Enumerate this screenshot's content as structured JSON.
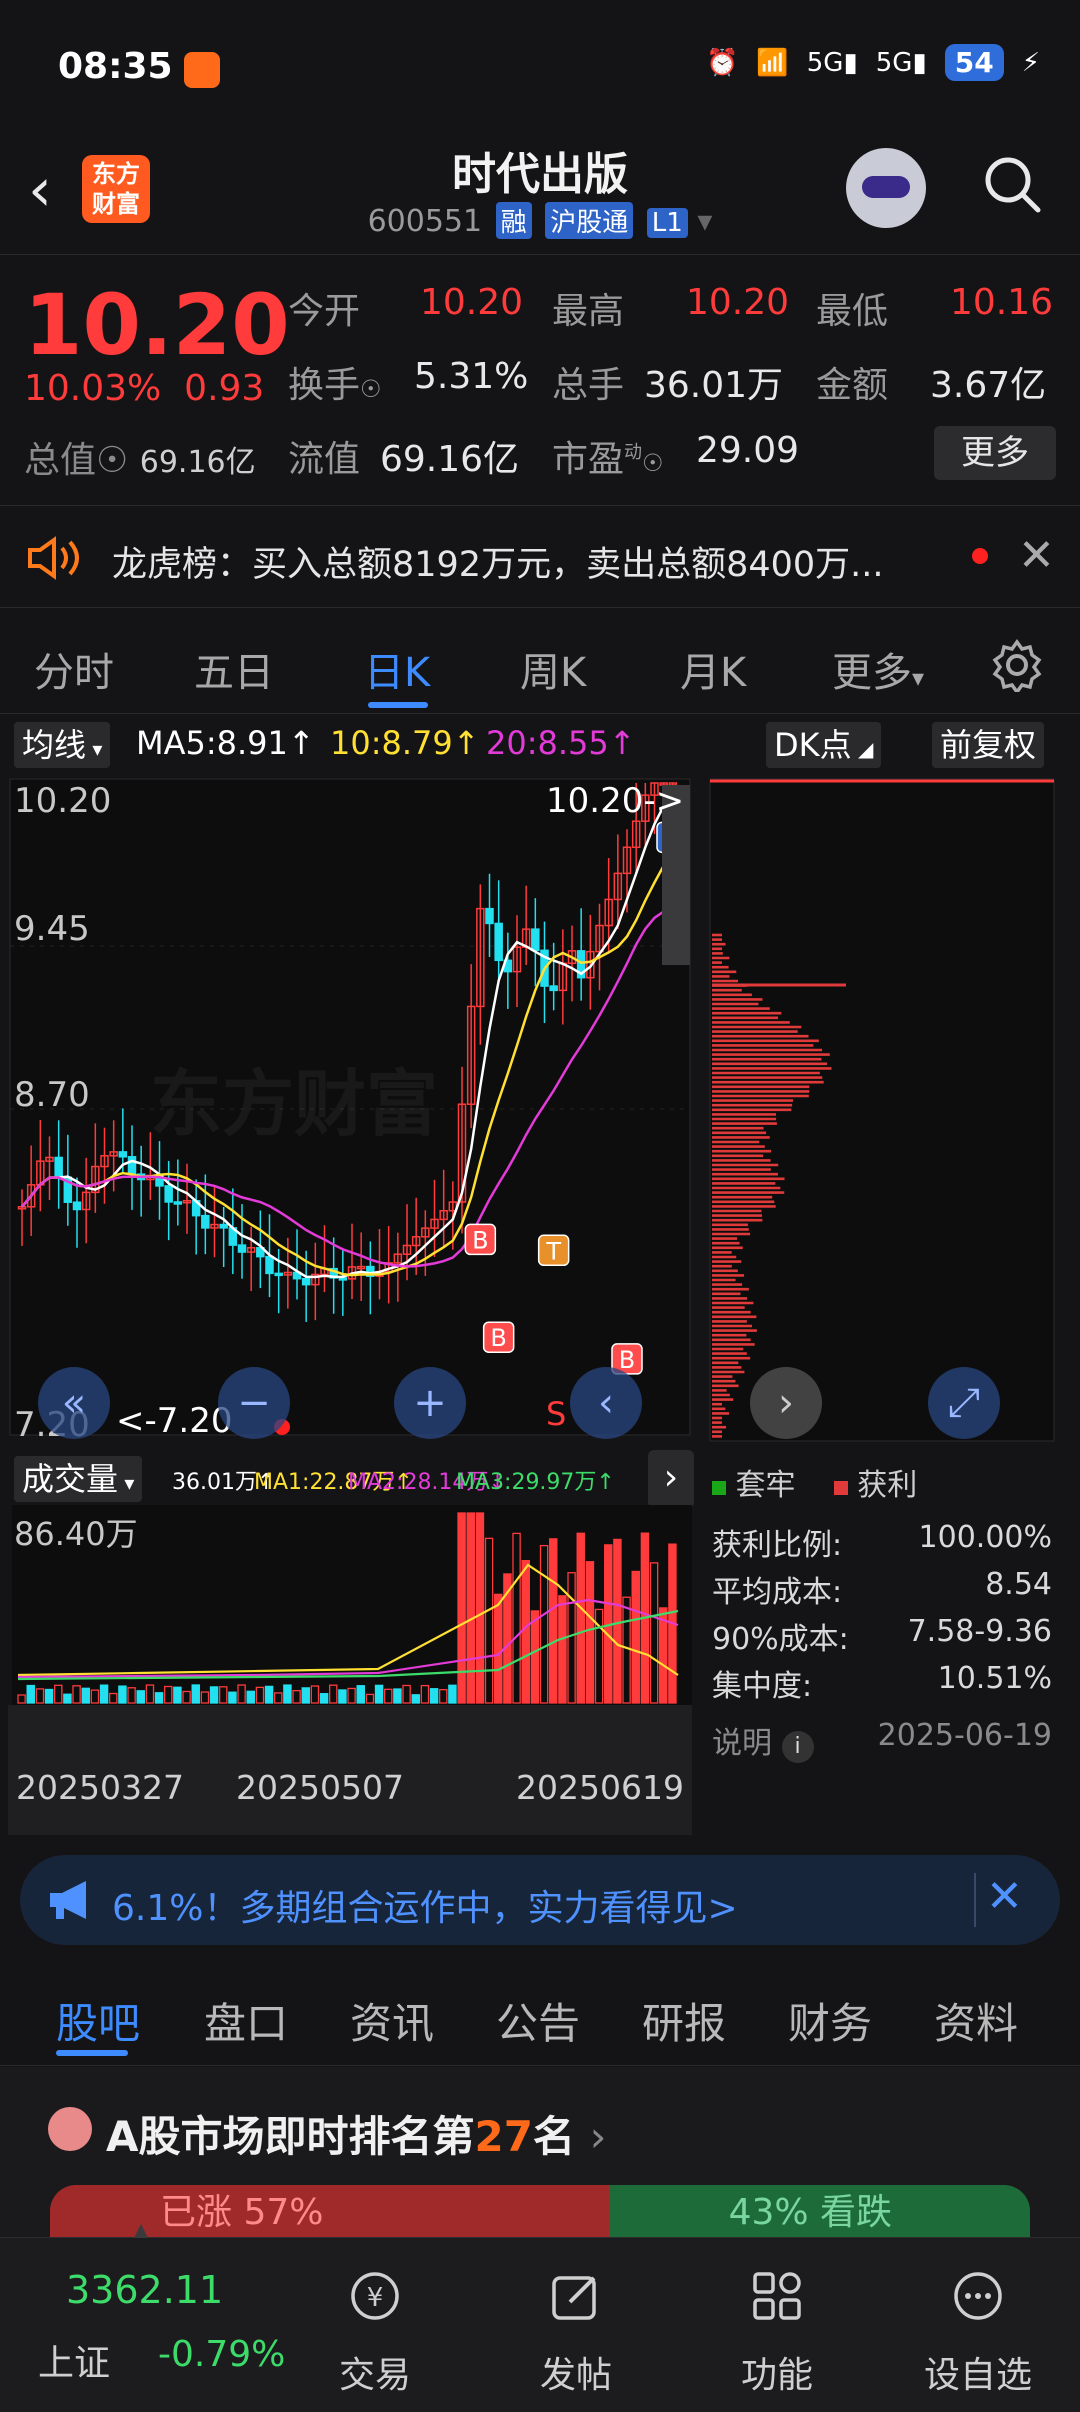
{
  "status": {
    "time": "08:35",
    "battery": "54",
    "net1": "5G",
    "net2": "5G"
  },
  "header": {
    "logo_line1": "东方",
    "logo_line2": "财富",
    "title": "时代出版",
    "code": "600551",
    "tags": [
      "融",
      "沪股通",
      "L1"
    ]
  },
  "quote": {
    "price": "10.20",
    "change_pct": "10.03%",
    "change_abs": "0.93",
    "total_cap_label": "总值",
    "total_cap_value": "69.16亿",
    "fields": [
      {
        "label": "今开",
        "value": "10.20",
        "color": "#ff3b3b"
      },
      {
        "label": "最高",
        "value": "10.20",
        "color": "#ff3b3b"
      },
      {
        "label": "最低",
        "value": "10.16",
        "color": "#ff3b3b"
      },
      {
        "label": "换手",
        "value": "5.31%",
        "color": "#e8e8e8"
      },
      {
        "label": "总手",
        "value": "36.01万",
        "color": "#e8e8e8"
      },
      {
        "label": "金额",
        "value": "3.67亿",
        "color": "#e8e8e8"
      },
      {
        "label": "流值",
        "value": "69.16亿",
        "color": "#e8e8e8"
      },
      {
        "label": "市盈",
        "value": "29.09",
        "color": "#e8e8e8"
      }
    ],
    "pe_sup": "动",
    "more_label": "更多"
  },
  "dragon": {
    "text": "龙虎榜：买入总额8192万元，卖出总额8400万..."
  },
  "ktabs": {
    "items": [
      "分时",
      "五日",
      "日K",
      "周K",
      "月K",
      "更多"
    ],
    "active": "日K"
  },
  "toolbar": {
    "ma_select": "均线",
    "ma5": "MA5:8.91",
    "ma10": "10:8.79",
    "ma20": "20:8.55",
    "dk": "DK点",
    "adjust": "前复权",
    "ma5_color": "#ffffff",
    "ma10_color": "#ffe033",
    "ma20_color": "#e23bd8"
  },
  "kchart": {
    "y_labels": [
      "10.20",
      "9.45",
      "8.70",
      "7.20"
    ],
    "last_tag": "10.20->",
    "low_tag": "<-7.20",
    "watermark": "东方财富",
    "markers": {
      "buy": "B",
      "sell": "S",
      "t": "T"
    }
  },
  "chart_data": {
    "type": "candlestick",
    "ylim": [
      7.2,
      10.2
    ],
    "ma_values": {
      "MA5": 8.91,
      "MA10": 8.79,
      "MA20": 8.55
    },
    "volume": {
      "max_label": "86.40万",
      "today": "36.01万",
      "MA1": "22.87万",
      "MA2": "28.14万",
      "MA3": "29.97万"
    },
    "x_labels": [
      "20250327",
      "20250507",
      "20250619"
    ]
  },
  "volbar": {
    "select": "成交量",
    "v": "36.01万↑",
    "ma1": "MA1:22.87万↑",
    "ma2": "MA2:28.14万↓",
    "ma3": "MA3:29.97万↑"
  },
  "chips": {
    "legend": [
      "套牢",
      "获利"
    ],
    "stats": [
      {
        "label": "获利比例:",
        "value": "100.00%"
      },
      {
        "label": "平均成本:",
        "value": "8.54"
      },
      {
        "label": "90%成本:",
        "value": "7.58-9.36"
      },
      {
        "label": "集中度:",
        "value": "10.51%"
      }
    ],
    "note_label": "说明",
    "date": "2025-06-19"
  },
  "promo": {
    "text": "6.1%！多期组合运作中，实力看得见>"
  },
  "sectabs": {
    "items": [
      "股吧",
      "盘口",
      "资讯",
      "公告",
      "研报",
      "财务",
      "资料"
    ],
    "active": "股吧"
  },
  "rank": {
    "prefix": "A股市场即时排名第",
    "num": "27",
    "suffix": "名",
    "left": "已涨 57%",
    "right": "43% 看跌"
  },
  "bottom": {
    "index_value": "3362.11",
    "index_name": "上证",
    "index_change": "-0.79%",
    "items": [
      "交易",
      "发帖",
      "功能",
      "设自选"
    ]
  }
}
